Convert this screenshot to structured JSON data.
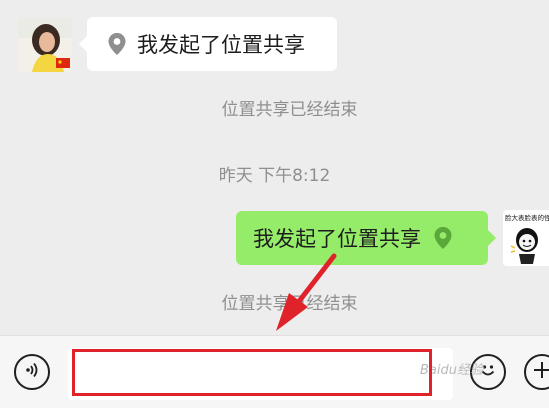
{
  "messages": {
    "received": {
      "text": "我发起了位置共享",
      "icon": "location-pin-icon"
    },
    "system_1": "位置共享已经结束",
    "timestamp": "昨天 下午8:12",
    "sent": {
      "text": "我发起了位置共享",
      "icon": "location-pin-icon"
    },
    "system_2": "位置共享已经结束"
  },
  "avatar_right_caption": "脸大表脸表的怪",
  "input_bar": {
    "voice_icon": "voice-icon",
    "emoji_icon": "emoji-icon",
    "plus_icon": "plus-icon",
    "placeholder": ""
  },
  "watermark": "Baidu经验",
  "colors": {
    "background": "#ededed",
    "sent_bubble": "#95ec69",
    "received_bubble": "#ffffff",
    "annotation": "#e0222a",
    "location_icon": "#8f8f8f"
  }
}
